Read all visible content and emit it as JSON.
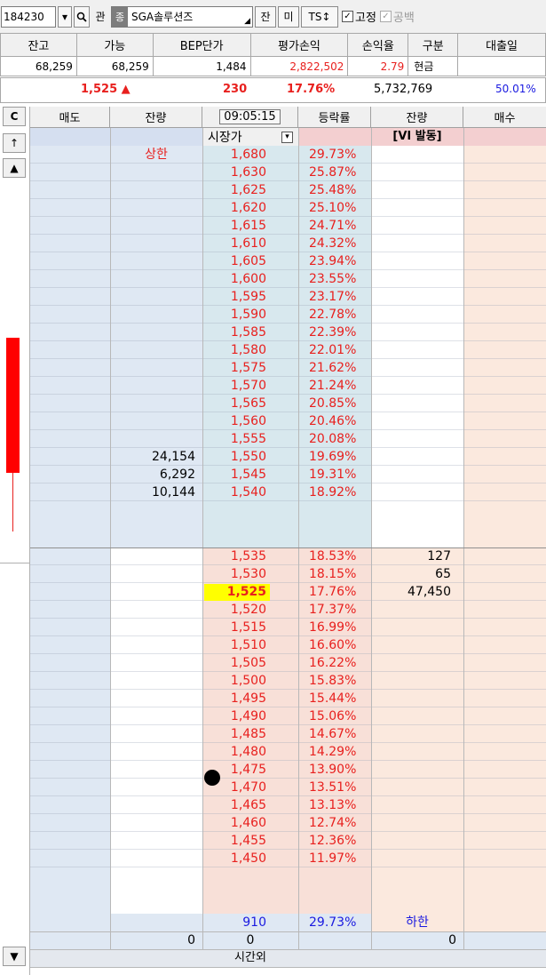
{
  "toolbar": {
    "code": "184230",
    "btn_pan": "관",
    "badge": "종",
    "stock_name": "SGA솔루션즈",
    "btn_jan": "잔",
    "btn_mi": "미",
    "btn_ts": "TS↕",
    "chk_fixed": "고정",
    "chk_short": "공백"
  },
  "account": {
    "headers": [
      "잔고",
      "가능",
      "BEP단가",
      "평가손익",
      "손익율",
      "구분",
      "대출일"
    ],
    "values": [
      "68,259",
      "68,259",
      "1,484",
      "2,822,502",
      "2.79",
      "현금",
      ""
    ]
  },
  "summary": {
    "price": "1,525 ▲",
    "change": "230",
    "rate": "17.76%",
    "volume": "5,732,769",
    "ratio": "50.01%"
  },
  "strip": {
    "c_label": "C",
    "up": "↑",
    "up_tri": "▲",
    "down_tri": "▼"
  },
  "book_headers": {
    "sell": "매도",
    "sell_qty": "잔량",
    "time": "09:05:15",
    "rate": "등락률",
    "buy_qty": "잔량",
    "buy": "매수"
  },
  "sub_header": {
    "open_price": "시장가",
    "vi": "[VI 발동]"
  },
  "upper_limit": "상한",
  "lower_limit": "하한",
  "asks": [
    {
      "price": "1,680",
      "rate": "29.73%",
      "qty": ""
    },
    {
      "price": "1,630",
      "rate": "25.87%",
      "qty": ""
    },
    {
      "price": "1,625",
      "rate": "25.48%",
      "qty": ""
    },
    {
      "price": "1,620",
      "rate": "25.10%",
      "qty": ""
    },
    {
      "price": "1,615",
      "rate": "24.71%",
      "qty": ""
    },
    {
      "price": "1,610",
      "rate": "24.32%",
      "qty": ""
    },
    {
      "price": "1,605",
      "rate": "23.94%",
      "qty": ""
    },
    {
      "price": "1,600",
      "rate": "23.55%",
      "qty": ""
    },
    {
      "price": "1,595",
      "rate": "23.17%",
      "qty": ""
    },
    {
      "price": "1,590",
      "rate": "22.78%",
      "qty": ""
    },
    {
      "price": "1,585",
      "rate": "22.39%",
      "qty": ""
    },
    {
      "price": "1,580",
      "rate": "22.01%",
      "qty": ""
    },
    {
      "price": "1,575",
      "rate": "21.62%",
      "qty": ""
    },
    {
      "price": "1,570",
      "rate": "21.24%",
      "qty": ""
    },
    {
      "price": "1,565",
      "rate": "20.85%",
      "qty": ""
    },
    {
      "price": "1,560",
      "rate": "20.46%",
      "qty": ""
    },
    {
      "price": "1,555",
      "rate": "20.08%",
      "qty": ""
    },
    {
      "price": "1,550",
      "rate": "19.69%",
      "qty": "24,154"
    },
    {
      "price": "1,545",
      "rate": "19.31%",
      "qty": "6,292"
    },
    {
      "price": "1,540",
      "rate": "18.92%",
      "qty": "10,144"
    }
  ],
  "bids": [
    {
      "price": "1,535",
      "rate": "18.53%",
      "qty": "127"
    },
    {
      "price": "1,530",
      "rate": "18.15%",
      "qty": "65"
    },
    {
      "price": "1,525",
      "rate": "17.76%",
      "qty": "47,450"
    },
    {
      "price": "1,520",
      "rate": "17.37%",
      "qty": ""
    },
    {
      "price": "1,515",
      "rate": "16.99%",
      "qty": ""
    },
    {
      "price": "1,510",
      "rate": "16.60%",
      "qty": ""
    },
    {
      "price": "1,505",
      "rate": "16.22%",
      "qty": ""
    },
    {
      "price": "1,500",
      "rate": "15.83%",
      "qty": ""
    },
    {
      "price": "1,495",
      "rate": "15.44%",
      "qty": ""
    },
    {
      "price": "1,490",
      "rate": "15.06%",
      "qty": ""
    },
    {
      "price": "1,485",
      "rate": "14.67%",
      "qty": ""
    },
    {
      "price": "1,480",
      "rate": "14.29%",
      "qty": ""
    },
    {
      "price": "1,475",
      "rate": "13.90%",
      "qty": ""
    },
    {
      "price": "1,470",
      "rate": "13.51%",
      "qty": ""
    },
    {
      "price": "1,465",
      "rate": "13.13%",
      "qty": ""
    },
    {
      "price": "1,460",
      "rate": "12.74%",
      "qty": ""
    },
    {
      "price": "1,455",
      "rate": "12.36%",
      "qty": ""
    },
    {
      "price": "1,450",
      "rate": "11.97%",
      "qty": ""
    }
  ],
  "lower_row": {
    "price": "910",
    "rate": "29.73%"
  },
  "totals": {
    "sell": "0",
    "mid": "0",
    "buy": "0"
  },
  "after_hours": "시간외",
  "colors": {
    "ask_bg": "#dfe8f3",
    "price_ask_bg": "#d8e8ee",
    "bid_bg": "#fbe9de",
    "price_bid_bg": "#f8e0d8",
    "up_red": "#e8201e",
    "down_blue": "#1a1ae0",
    "current_highlight": "#ffff00"
  }
}
